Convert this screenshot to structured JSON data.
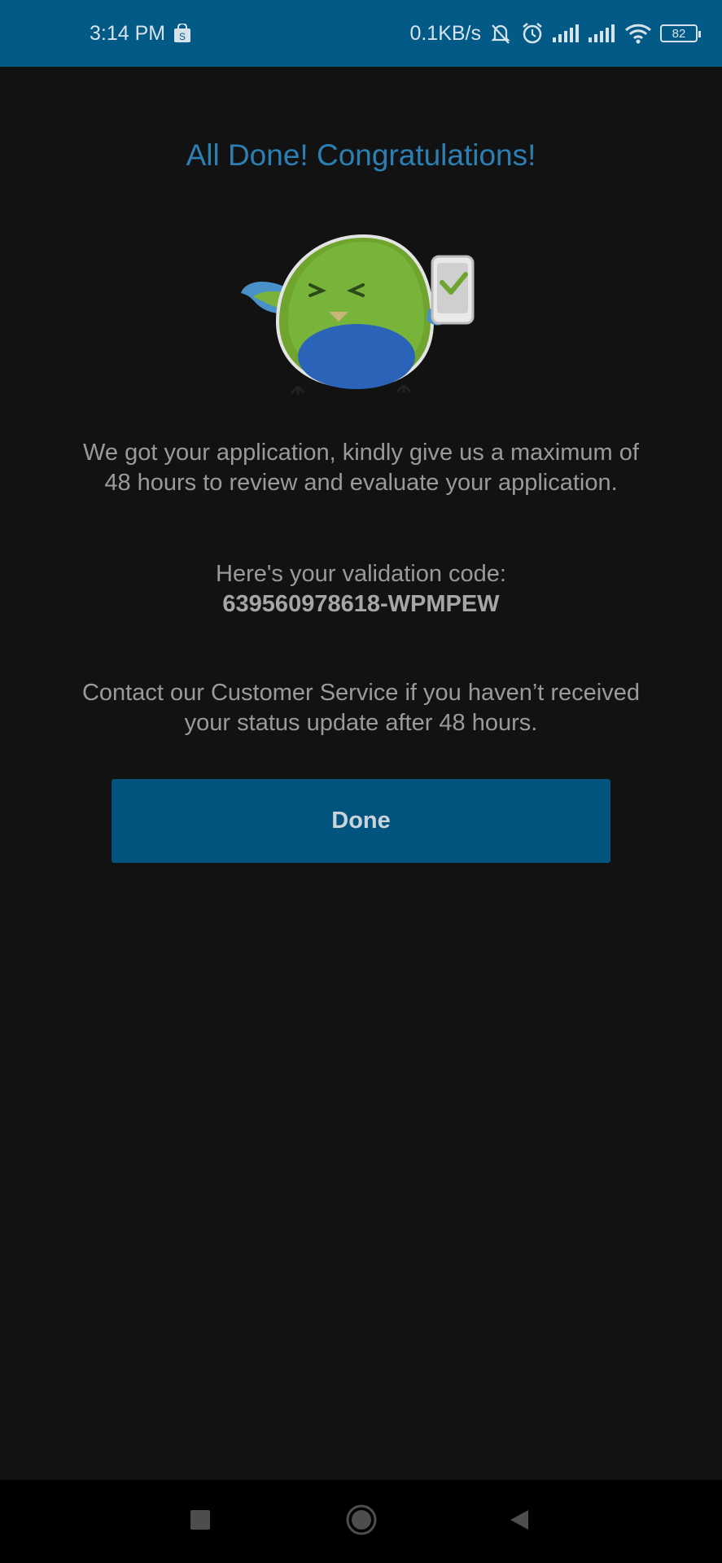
{
  "status_bar": {
    "time": "3:14 PM",
    "net_speed": "0.1KB/s",
    "battery": "82",
    "icons": [
      "shop-bag-icon",
      "bell-off-icon",
      "alarm-icon",
      "signal-icon",
      "signal-icon",
      "wifi-icon",
      "battery-icon"
    ]
  },
  "main": {
    "title": "All Done! Congratulations!",
    "message_line1": "We got your application, kindly give us a maximum of",
    "message_line2": "48 hours to review and evaluate your application.",
    "code_label": "Here's your validation code:",
    "code_value": "639560978618-WPMPEW",
    "contact_line1": "Contact our Customer Service if you haven’t received",
    "contact_line2": "your status update after 48 hours.",
    "done_label": "Done"
  },
  "nav_bar": {
    "icons": [
      "recents-square-icon",
      "home-circle-icon",
      "back-triangle-icon"
    ]
  },
  "colors": {
    "status_bar": "#035a86",
    "background": "#121212",
    "title": "#2b7fb3",
    "button": "#02547f"
  }
}
